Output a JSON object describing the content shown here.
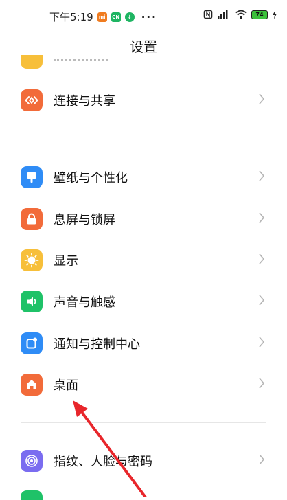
{
  "status_bar": {
    "time": "下午5:19",
    "icons": [
      "mi-app-icon",
      "cn-app-icon",
      "download-icon"
    ],
    "more": "···",
    "battery": "74"
  },
  "header": {
    "title": "设置"
  },
  "settings": {
    "items": [
      {
        "label": "连接与共享",
        "icon": "share-icon",
        "color": "#f26b3a"
      },
      {
        "label": "壁纸与个性化",
        "icon": "wallpaper-icon",
        "color": "#2f8cf6"
      },
      {
        "label": "息屏与锁屏",
        "icon": "lock-icon",
        "color": "#f26b3a"
      },
      {
        "label": "显示",
        "icon": "sun-icon",
        "color": "#f7bf3a"
      },
      {
        "label": "声音与触感",
        "icon": "speaker-icon",
        "color": "#1fc268"
      },
      {
        "label": "通知与控制中心",
        "icon": "notification-icon",
        "color": "#2f8cf6"
      },
      {
        "label": "桌面",
        "icon": "home-icon",
        "color": "#f26b3a"
      },
      {
        "label": "指纹、人脸与密码",
        "icon": "fingerprint-icon",
        "color": "#7a6cf0"
      }
    ],
    "chevron": ">"
  },
  "annotation": {
    "arrow_color": "#e8262b"
  }
}
